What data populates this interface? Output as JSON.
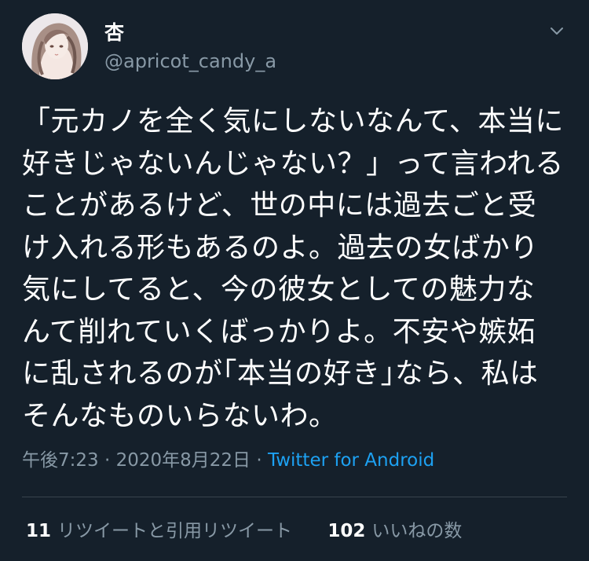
{
  "colors": {
    "background": "#15202b",
    "primary_text": "#ffffff",
    "secondary_text": "#8899a6",
    "link": "#1da1f2",
    "divider": "#38444d"
  },
  "user": {
    "display_name": "杏",
    "username": "@apricot_candy_a",
    "avatar_icon": "avatar-illustration"
  },
  "menu_icon": "chevron-down-icon",
  "tweet": {
    "lines": [
      "「元カノを全く気にしないなんて、本当に",
      "好きじゃないんじゃない？」って言われる",
      "ことがあるけど、世の中には過去ごと受",
      "け入れる形もあるのよ。過去の女ばかり",
      "気にしてると、今の彼女としての魅力な",
      "んて削れていくばっかりよ。不安や嫉妬",
      "に乱されるのが｢本当の好き｣なら、私は",
      "そんなものいらないわ。"
    ]
  },
  "meta": {
    "time": "午後7:23",
    "separator": " · ",
    "date": "2020年8月22日",
    "source": "Twitter for Android"
  },
  "stats": {
    "retweets_count": "11",
    "retweets_label": "リツイートと引用リツイート",
    "likes_count": "102",
    "likes_label": "いいねの数"
  }
}
